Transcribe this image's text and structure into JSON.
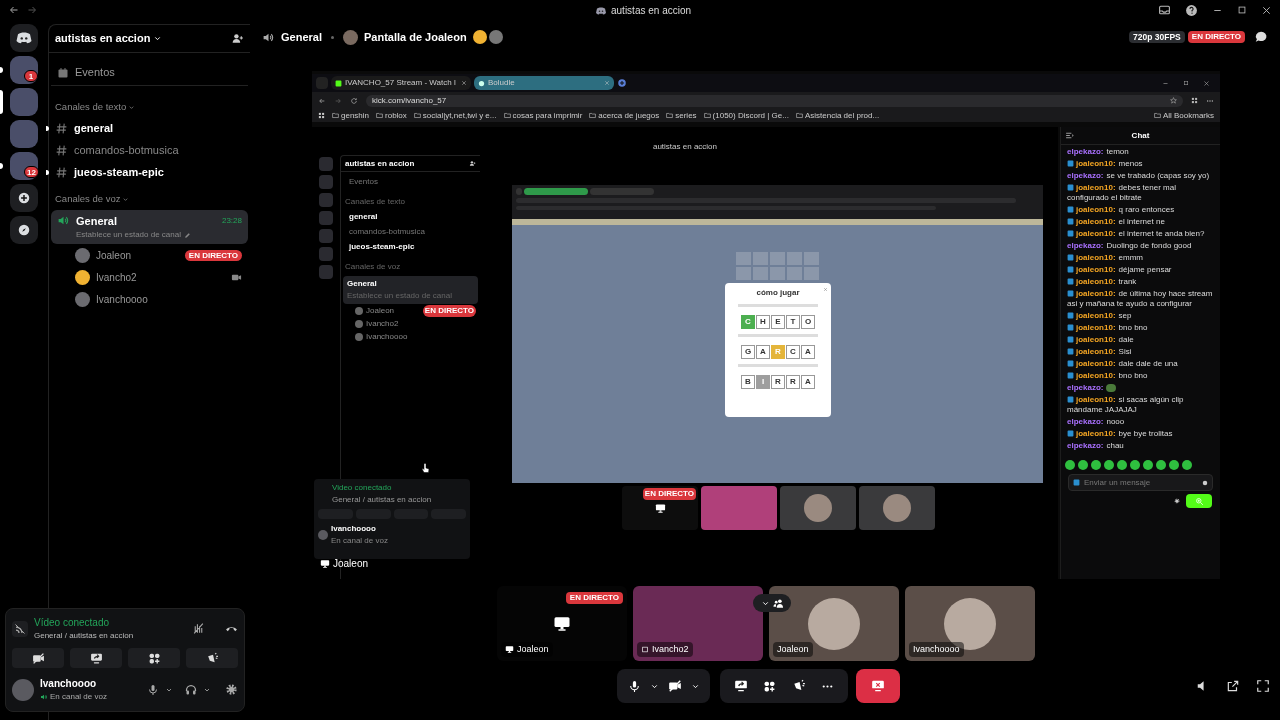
{
  "title_bar": {
    "title": "autistas en accion"
  },
  "servers": [
    {
      "kind": "home",
      "selected": false,
      "unread": false
    },
    {
      "kind": "server",
      "selected": false,
      "unread": true,
      "badge": "1"
    },
    {
      "kind": "server",
      "selected": true,
      "unread": false
    },
    {
      "kind": "server",
      "selected": false,
      "unread": false
    },
    {
      "kind": "server",
      "selected": false,
      "unread": true,
      "badge": "12"
    },
    {
      "kind": "add",
      "selected": false,
      "unread": false
    },
    {
      "kind": "explore",
      "selected": false,
      "unread": false
    }
  ],
  "sidebar": {
    "server_name": "autistas en accion",
    "events": "Eventos",
    "text_header": "Canales de texto",
    "text_channels": [
      {
        "name": "general",
        "unread": true
      },
      {
        "name": "comandos-botmusica",
        "unread": false
      },
      {
        "name": "jueos-steam-epic",
        "unread": true
      }
    ],
    "voice_header": "Canales de voz",
    "voice_channels": [
      {
        "name": "General",
        "status": "Establece un estado de canal",
        "time": "23:28",
        "selected": true,
        "members": [
          {
            "name": "Joaleon",
            "kind": "photo",
            "live": "EN DIRECTO",
            "camera": false
          },
          {
            "name": "Ivancho2",
            "kind": "default",
            "camera": true
          },
          {
            "name": "Ivanchoooo",
            "kind": "photo",
            "camera": false
          }
        ]
      }
    ]
  },
  "voice_panel": {
    "status": "Vídeo conectado",
    "location": "General / autistas en accion"
  },
  "user": {
    "name": "Ivanchoooo",
    "status": "En canal de voz"
  },
  "header": {
    "channel": "General",
    "stream_title": "Pantalla de Joaleon",
    "quality": "720p 30FPS",
    "live": "EN DIRECTO"
  },
  "stream": {
    "label": "Joaleon",
    "browser": {
      "tabs": [
        {
          "title": "IVANCHO_57 Stream - Watch l",
          "selected": false
        },
        {
          "title": "Boludle",
          "selected": true
        }
      ],
      "url": "kick.com/ivancho_57",
      "bookmarks": [
        "genshin",
        "roblox",
        "social|yt,net,twi y e...",
        "cosas para imprimir",
        "acerca de juegos",
        "series",
        "(1050) Discord | Ge...",
        "Asistencia del prod..."
      ],
      "all_bookmarks": "All Bookmarks"
    },
    "nested_discord": {
      "title": "autistas en accion",
      "server_name": "autistas en accion",
      "events": "Eventos",
      "text_header": "Canales de texto",
      "text_channels": [
        {
          "name": "general",
          "unread": true
        },
        {
          "name": "comandos-botmusica",
          "unread": false
        },
        {
          "name": "jueos-steam-epic",
          "unread": true
        }
      ],
      "voice_header": "Canales de voz",
      "voice_channel": "General",
      "voice_status": "Establece un estado de canal",
      "members": [
        {
          "name": "Joaleon",
          "live": "EN DIRECTO"
        },
        {
          "name": "Ivancho2"
        },
        {
          "name": "Ivanchoooo"
        }
      ],
      "panel_status": "Video conectado",
      "panel_location": "General / autistas en accion",
      "user_name": "Ivanchoooo",
      "user_status": "En canal de voz",
      "game": {
        "title": "cómo jugar",
        "rows": [
          [
            {
              "letter": "C",
              "kind": "correct"
            },
            {
              "letter": "H",
              "kind": "plain"
            },
            {
              "letter": "E",
              "kind": "plain"
            },
            {
              "letter": "T",
              "kind": "plain"
            },
            {
              "letter": "O",
              "kind": "plain"
            }
          ],
          [
            {
              "letter": "G",
              "kind": "plain"
            },
            {
              "letter": "A",
              "kind": "plain"
            },
            {
              "letter": "R",
              "kind": "present"
            },
            {
              "letter": "C",
              "kind": "plain"
            },
            {
              "letter": "A",
              "kind": "plain"
            }
          ],
          [
            {
              "letter": "B",
              "kind": "plain"
            },
            {
              "letter": "I",
              "kind": "absent"
            },
            {
              "letter": "R",
              "kind": "plain"
            },
            {
              "letter": "R",
              "kind": "plain"
            },
            {
              "letter": "A",
              "kind": "plain"
            }
          ]
        ]
      },
      "tiles": [
        {
          "kind": "screen",
          "live": "EN DIRECTO"
        },
        {
          "kind": "video"
        },
        {
          "kind": "avatar"
        },
        {
          "kind": "avatar"
        }
      ]
    },
    "chat": {
      "title": "Chat",
      "placeholder": "Enviar un mensaje",
      "messages": [
        {
          "user": "elpekazo:",
          "color": "#a970ff",
          "badge": false,
          "text": "temon"
        },
        {
          "user": "joaleon10:",
          "color": "#f5a623",
          "badge": true,
          "text": "menos"
        },
        {
          "user": "elpekazo:",
          "color": "#a970ff",
          "badge": false,
          "text": "se ve trabado (capas soy yo)"
        },
        {
          "user": "joaleon10:",
          "color": "#f5a623",
          "badge": true,
          "text": "debes tener mal configurado el bitrate"
        },
        {
          "user": "joaleon10:",
          "color": "#f5a623",
          "badge": true,
          "text": "q raro entonces"
        },
        {
          "user": "joaleon10:",
          "color": "#f5a623",
          "badge": true,
          "text": "el internet ne"
        },
        {
          "user": "joaleon10:",
          "color": "#f5a623",
          "badge": true,
          "text": "el internet te anda bien?"
        },
        {
          "user": "elpekazo:",
          "color": "#a970ff",
          "badge": false,
          "text": "Duolingo de fondo good"
        },
        {
          "user": "joaleon10:",
          "color": "#f5a623",
          "badge": true,
          "text": "emmm"
        },
        {
          "user": "joaleon10:",
          "color": "#f5a623",
          "badge": true,
          "text": "déjame pensar"
        },
        {
          "user": "joaleon10:",
          "color": "#f5a623",
          "badge": true,
          "text": "trank"
        },
        {
          "user": "joaleon10:",
          "color": "#f5a623",
          "badge": true,
          "text": "de última hoy hace stream asi y mañana te ayudo a configurar"
        },
        {
          "user": "joaleon10:",
          "color": "#f5a623",
          "badge": true,
          "text": "sep"
        },
        {
          "user": "joaleon10:",
          "color": "#f5a623",
          "badge": true,
          "text": "bno bno"
        },
        {
          "user": "joaleon10:",
          "color": "#f5a623",
          "badge": true,
          "text": "dale"
        },
        {
          "user": "joaleon10:",
          "color": "#f5a623",
          "badge": true,
          "text": "Sisi"
        },
        {
          "user": "joaleon10:",
          "color": "#f5a623",
          "badge": true,
          "text": "dale dale de una"
        },
        {
          "user": "joaleon10:",
          "color": "#f5a623",
          "badge": true,
          "text": "bno bno"
        },
        {
          "user": "elpekazo:",
          "color": "#a970ff",
          "badge": false,
          "kind": "emote"
        },
        {
          "user": "joaleon10:",
          "color": "#f5a623",
          "badge": true,
          "text": "si sacas algún clip mándame JAJAJAJ"
        },
        {
          "user": "elpekazo:",
          "color": "#a970ff",
          "badge": false,
          "text": "nooo"
        },
        {
          "user": "joaleon10:",
          "color": "#f5a623",
          "badge": true,
          "text": "bye bye trolitas"
        },
        {
          "user": "elpekazo:",
          "color": "#a970ff",
          "badge": false,
          "text": "chau"
        }
      ]
    }
  },
  "tiles": [
    {
      "kind": "screen",
      "name": "Joaleon",
      "live": "EN DIRECTO"
    },
    {
      "kind": "video",
      "name": "Ivancho2"
    },
    {
      "kind": "avatar",
      "name": "Joaleon"
    },
    {
      "kind": "avatar",
      "name": "Ivanchoooo"
    }
  ]
}
